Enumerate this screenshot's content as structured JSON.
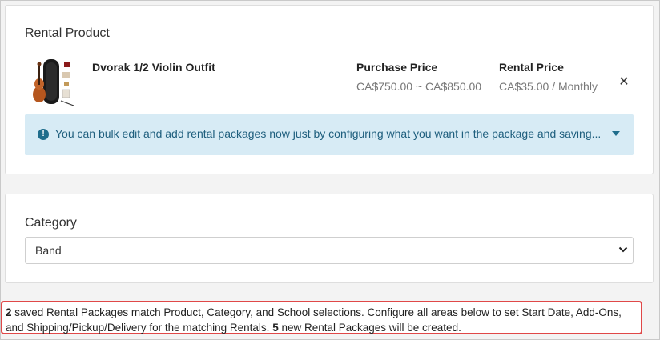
{
  "rental_product": {
    "section_title": "Rental Product",
    "product_name": "Dvorak 1/2 Violin Outfit",
    "purchase_price_label": "Purchase Price",
    "purchase_price_value": "CA$750.00 ~ CA$850.00",
    "rental_price_label": "Rental Price",
    "rental_price_value": "CA$35.00 / Monthly",
    "remove_icon": "close-icon",
    "remove_glyph": "✕"
  },
  "info_banner": {
    "icon": "exclamation-circle-icon",
    "icon_glyph": "!",
    "message": "You can bulk edit and add rental packages now just by configuring what you want in the package and saving...",
    "toggle_icon": "caret-down-icon"
  },
  "category": {
    "section_title": "Category",
    "selected_value": "Band",
    "chevron_icon": "chevron-down-icon"
  },
  "notice": {
    "saved_count": "2",
    "line_part1": " saved Rental Packages match Product, Category, and School selections. Configure all areas below to set Start Date, Add-Ons, and Shipping/Pickup/Delivery for the matching Rentals. ",
    "new_count": "5",
    "line_part2": " new Rental Packages will be created."
  },
  "colors": {
    "accent": "#1f6d8c",
    "banner_bg": "#d7ebf5",
    "highlight_border": "#e04848"
  }
}
